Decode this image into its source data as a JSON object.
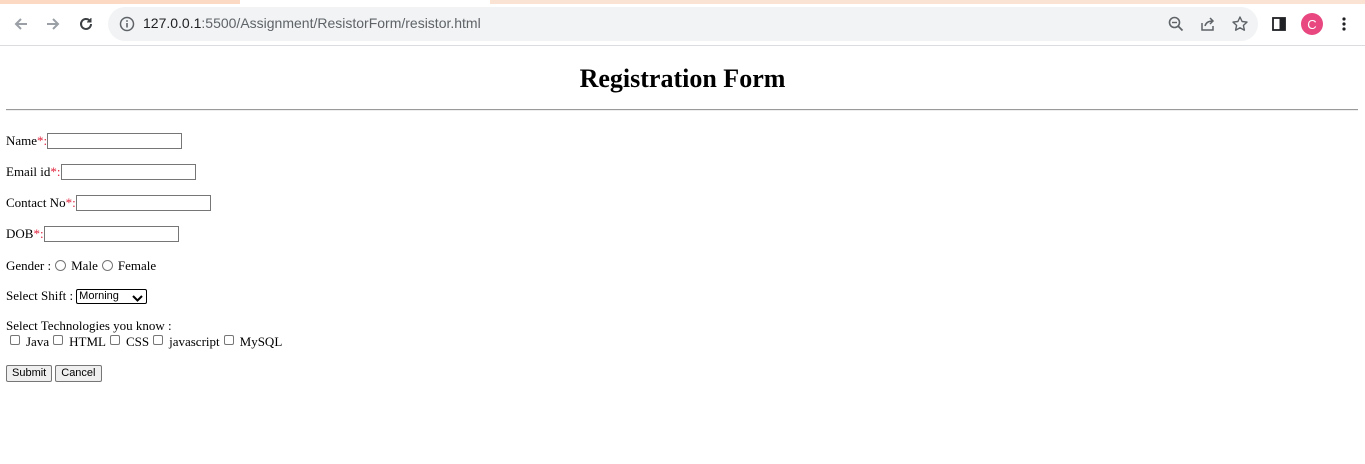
{
  "browser": {
    "url_host": "127.0.0.1",
    "url_path": ":5500/Assignment/ResistorForm/resistor.html",
    "avatar_letter": "C",
    "avatar_color": "#e8487f"
  },
  "form": {
    "title": "Registration Form",
    "name_label": "Name ",
    "email_label": "Email id ",
    "contact_label": "Contact No ",
    "dob_label": "DOB ",
    "required_mark": "*",
    "colon": ":",
    "gender_label": "Gender : ",
    "gender_options": [
      "Male",
      "Female"
    ],
    "shift_label": "Select Shift : ",
    "shift_selected": "Morning",
    "tech_label": "Select Technologies you know :",
    "technologies": [
      "Java",
      "HTML",
      "CSS",
      "javascript",
      "MySQL"
    ],
    "submit_label": "Submit",
    "cancel_label": "Cancel"
  }
}
